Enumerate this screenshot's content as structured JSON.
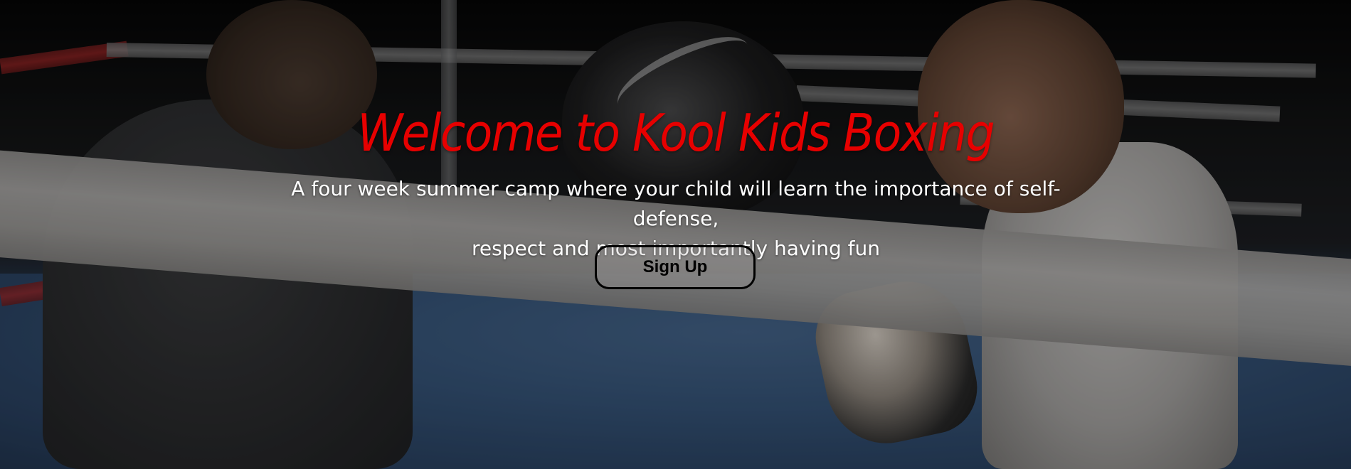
{
  "hero": {
    "title": "Welcome to Kool Kids Boxing",
    "subtitle_line1": "A four week summer camp where your child will learn the importance of self-defense,",
    "subtitle_line2": "respect and most importantly having fun",
    "signup_label": "Sign Up"
  },
  "colors": {
    "title": "#e70000",
    "subtitle": "#ffffff",
    "button_border": "#000000",
    "button_text": "#000000"
  }
}
